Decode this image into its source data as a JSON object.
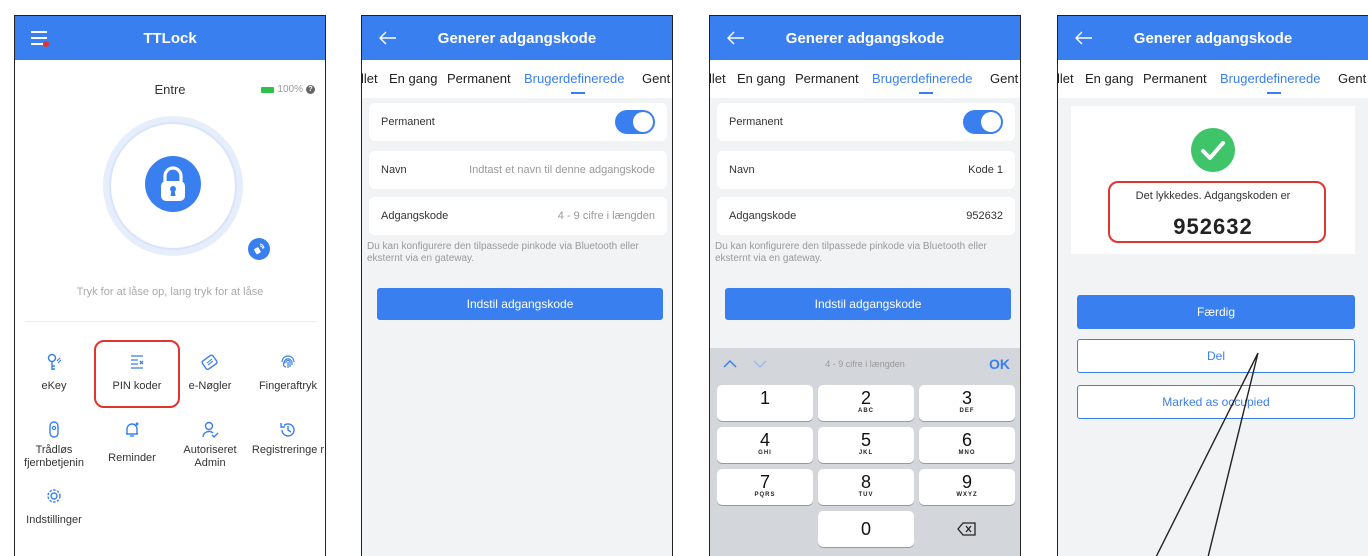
{
  "panel1": {
    "header_title": "TTLock",
    "lock_name": "Entre",
    "battery": "100%",
    "hint": "Tryk for at låse op, lang tryk for at låse",
    "menu": [
      {
        "label": "eKey",
        "icon": "key-person-icon"
      },
      {
        "label": "PIN koder",
        "icon": "pin-list-icon"
      },
      {
        "label": "e-Nøgler",
        "icon": "card-icon"
      },
      {
        "label": "Fingeraftryk",
        "icon": "fingerprint-icon"
      },
      {
        "label": "Trådløs fjernbetjenin",
        "icon": "remote-icon"
      },
      {
        "label": "Reminder",
        "icon": "bell-icon"
      },
      {
        "label": "Autoriseret Admin",
        "icon": "admin-icon"
      },
      {
        "label": "Registreringe r",
        "icon": "history-icon"
      },
      {
        "label": "Indstillinger",
        "icon": "gear-icon"
      }
    ],
    "colors": {
      "accent": "#3a7ff0",
      "highlight": "#e0342f",
      "battery": "#2fbf4b"
    }
  },
  "generate": {
    "header_title": "Generer adgangskode",
    "tabs": [
      "llet",
      "En gang",
      "Permanent",
      "Brugerdefinerede",
      "Gent"
    ],
    "active_tab": "Brugerdefinerede",
    "permanent_label": "Permanent",
    "name_label": "Navn",
    "name_placeholder": "Indtast et navn til denne adgangskode",
    "code_label": "Adgangskode",
    "code_placeholder": "4 - 9 cifre i længden",
    "note": "Du kan konfigurere den tilpassede pinkode via Bluetooth eller eksternt via en gateway.",
    "submit_label": "Indstil adgangskode"
  },
  "panel3": {
    "name_value": "Kode 1",
    "code_value": "952632",
    "keyboard_hint": "4 - 9 cifre i længden",
    "ok_label": "OK",
    "keys": [
      {
        "n": "1",
        "s": ""
      },
      {
        "n": "2",
        "s": "ABC"
      },
      {
        "n": "3",
        "s": "DEF"
      },
      {
        "n": "4",
        "s": "GHI"
      },
      {
        "n": "5",
        "s": "JKL"
      },
      {
        "n": "6",
        "s": "MNO"
      },
      {
        "n": "7",
        "s": "PQRS"
      },
      {
        "n": "8",
        "s": "TUV"
      },
      {
        "n": "9",
        "s": "WXYZ"
      },
      {
        "n": "",
        "s": ""
      },
      {
        "n": "0",
        "s": ""
      },
      {
        "n": "⌫",
        "s": ""
      }
    ]
  },
  "panel4": {
    "success_text": "Det lykkedes. Adgangskoden er",
    "code": "952632",
    "done_label": "Færdig",
    "share_label": "Del",
    "occupied_label": "Marked as occupied",
    "colors": {
      "success": "#3fc46a"
    }
  }
}
